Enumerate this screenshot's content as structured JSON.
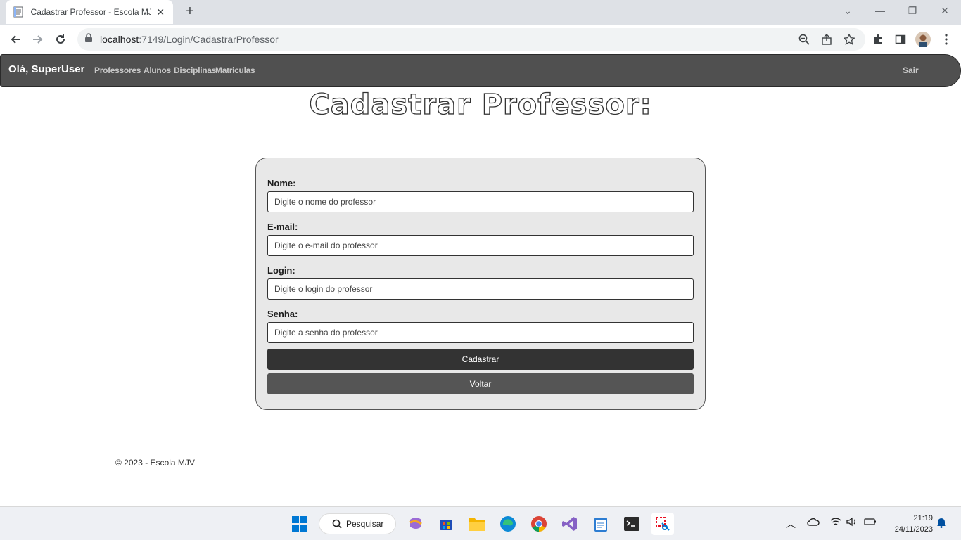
{
  "browser": {
    "tab_title": "Cadastrar Professor - Escola MJV",
    "url_host": "localhost",
    "url_path": ":7149/Login/CadastrarProfessor"
  },
  "navbar": {
    "greeting": "Olá, SuperUser",
    "links": [
      "Professores",
      "Alunos",
      "Disciplinas",
      "Matriculas"
    ],
    "logout": "Sair"
  },
  "page": {
    "title": "Cadastrar Professor:"
  },
  "form": {
    "fields": [
      {
        "label": "Nome:",
        "placeholder": "Digite o nome do professor"
      },
      {
        "label": "E-mail:",
        "placeholder": "Digite o e-mail do professor"
      },
      {
        "label": "Login:",
        "placeholder": "Digite o login do professor"
      },
      {
        "label": "Senha:",
        "placeholder": "Digite a senha do professor"
      }
    ],
    "submit_label": "Cadastrar",
    "back_label": "Voltar"
  },
  "footer": {
    "text": "© 2023 - Escola MJV"
  },
  "taskbar": {
    "search_label": "Pesquisar",
    "time": "21:19",
    "date": "24/11/2023"
  },
  "colors": {
    "navbar_bg": "#505050",
    "primary_button": "#333333",
    "secondary_button": "#555555",
    "card_bg": "#e8e8e8"
  }
}
